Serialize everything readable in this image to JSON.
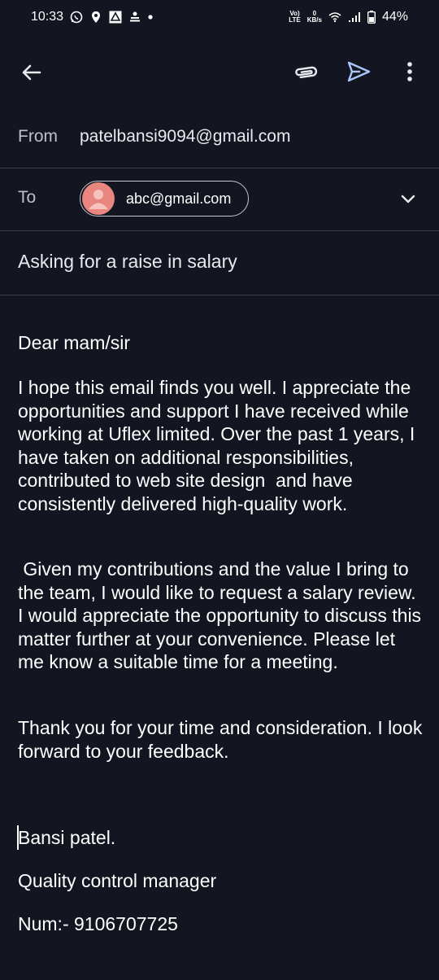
{
  "status_bar": {
    "time": "10:33",
    "network_top": "Vo)",
    "network_bottom": "LTE",
    "speed_top": "0",
    "speed_bottom": "KB/s",
    "battery": "44%"
  },
  "toolbar": {
    "back_icon": "arrow-left",
    "attach_icon": "paperclip",
    "send_icon": "send",
    "more_icon": "more-vertical"
  },
  "compose": {
    "from_label": "From",
    "from_value": "patelbansi9094@gmail.com",
    "to_label": "To",
    "to_chip": "abc@gmail.com",
    "subject": "Asking for a raise in salary"
  },
  "body": {
    "greeting": "Dear mam/sir",
    "paragraph1": "I hope this email finds you well. I appreciate the opportunities and support I have received while working at Uflex limited. Over the past 1 years, I have taken on additional responsibilities, contributed to web site design  and have consistently delivered high-quality work.",
    "paragraph2": " Given my contributions and the value I bring to the team, I would like to request a salary review. I would appreciate the opportunity to discuss this matter further at your convenience. Please let me know a suitable time for a meeting.",
    "paragraph3": "Thank you for your time and consideration. I look forward to your feedback.",
    "signature_name": "Bansi patel.",
    "signature_title": "Quality control manager",
    "signature_number": "Num:- 9106707725"
  },
  "colors": {
    "background": "#131620",
    "divider": "#3a3d45",
    "avatar": "#ea8680",
    "send_accent": "#a8c7fa"
  }
}
